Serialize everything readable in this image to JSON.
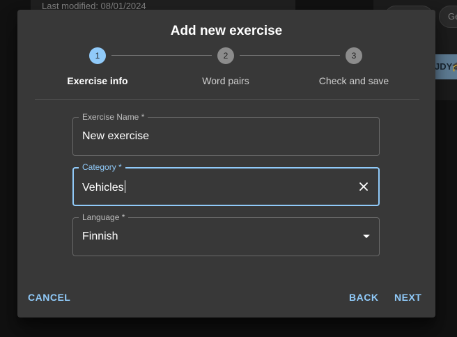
{
  "background": {
    "last_modified": "Last modified: 08/01/2024",
    "chip_text": "Ge",
    "study_button": "JDY"
  },
  "dialog": {
    "title": "Add new exercise",
    "steps": [
      {
        "number": "1",
        "label": "Exercise info",
        "active": true
      },
      {
        "number": "2",
        "label": "Word pairs",
        "active": false
      },
      {
        "number": "3",
        "label": "Check and save",
        "active": false
      }
    ],
    "fields": {
      "exercise_name": {
        "label": "Exercise Name *",
        "value": "New exercise"
      },
      "category": {
        "label": "Category *",
        "value": "Vehicles"
      },
      "language": {
        "label": "Language *",
        "value": "Finnish"
      }
    },
    "actions": {
      "cancel": "CANCEL",
      "back": "BACK",
      "next": "NEXT"
    }
  },
  "colors": {
    "accent": "#90caf9",
    "dialog_bg": "#383838"
  }
}
